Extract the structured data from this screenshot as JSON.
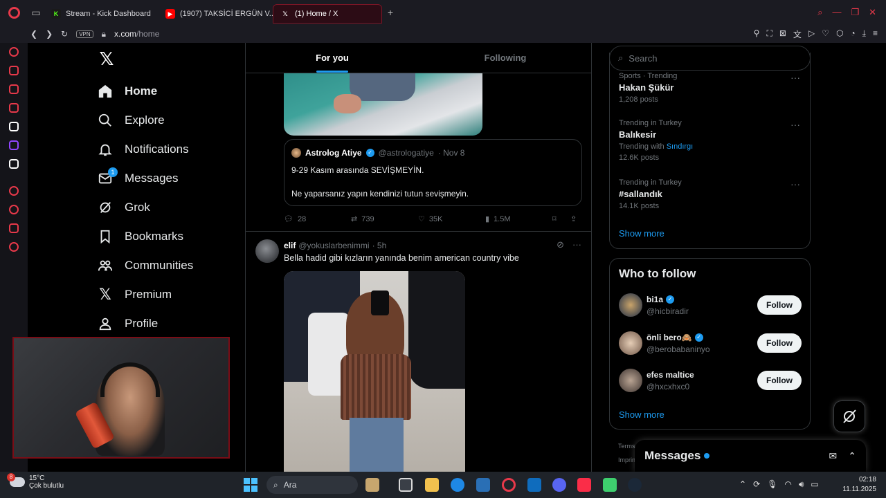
{
  "browser": {
    "tabs": [
      {
        "label": "Stream - Kick Dashboard",
        "favicon": "kick-icon"
      },
      {
        "label": "(1907) TAKSİCİ ERGÜN V...",
        "favicon": "youtube-icon"
      },
      {
        "label": "(1) Home / X",
        "favicon": "x-icon",
        "active": true
      }
    ],
    "new_tab": "+",
    "vpn_label": "VPN",
    "url_domain": "x.com",
    "url_path": "/home"
  },
  "xnav": {
    "logo": "𝕏",
    "items": [
      {
        "label": "Home",
        "icon": "home-icon",
        "active": true
      },
      {
        "label": "Explore",
        "icon": "search-icon"
      },
      {
        "label": "Notifications",
        "icon": "bell-icon"
      },
      {
        "label": "Messages",
        "icon": "mail-icon",
        "badge": "1"
      },
      {
        "label": "Grok",
        "icon": "grok-icon"
      },
      {
        "label": "Bookmarks",
        "icon": "bookmark-icon"
      },
      {
        "label": "Communities",
        "icon": "communities-icon"
      },
      {
        "label": "Premium",
        "icon": "x-premium-icon"
      },
      {
        "label": "Profile",
        "icon": "profile-icon"
      }
    ]
  },
  "feed": {
    "tabs": [
      "For you",
      "Following"
    ],
    "quote": {
      "name": "Astrolog Atiye",
      "handle": "@astrologatiye",
      "date": "· Nov 8",
      "line1": "9-29 Kasım arasında SEVİŞMEYİN.",
      "line2": "Ne yaparsanız yapın kendinizi tutun sevişmeyin."
    },
    "actions1": {
      "replies": "28",
      "reposts": "739",
      "likes": "35K",
      "views": "1.5M"
    },
    "tweet2": {
      "name": "elif",
      "handle": "@yokuslarbenimmi",
      "time": "· 5h",
      "text": "Bella hadid gibi kızların yanında benim american country vibe"
    }
  },
  "right": {
    "search_placeholder": "Search",
    "trends": [
      {
        "context": "Sports · Trending",
        "name": "Hakan Şükür",
        "posts": "1,208 posts"
      },
      {
        "context": "Trending in Turkey",
        "name": "Balıkesir",
        "with_label": "Trending with",
        "with_value": "Sındırgı",
        "posts": "12.6K posts"
      },
      {
        "context": "Trending in Turkey",
        "name": "#sallandık",
        "posts": "14.1K posts"
      }
    ],
    "show_more": "Show more",
    "who_to_follow": {
      "title": "Who to follow",
      "users": [
        {
          "name": "bi1a",
          "handle": "@hicbiradir",
          "verified": true,
          "button": "Follow"
        },
        {
          "name": "önli bero🙈",
          "handle": "@berobabaninyo",
          "verified": true,
          "button": "Follow"
        },
        {
          "name": "efes maltice",
          "handle": "@hxcxhxc0",
          "verified": false,
          "button": "Follow"
        }
      ],
      "show_more": "Show more"
    },
    "footer_terms": "Terms",
    "footer_imprint": "Imprint"
  },
  "messages_drawer": {
    "title": "Messages"
  },
  "taskbar": {
    "weather_badge": "8",
    "temperature": "15°C",
    "condition": "Çok bulutlu",
    "search_placeholder": "Ara",
    "time": "02:18",
    "date": "11.11.2025"
  }
}
